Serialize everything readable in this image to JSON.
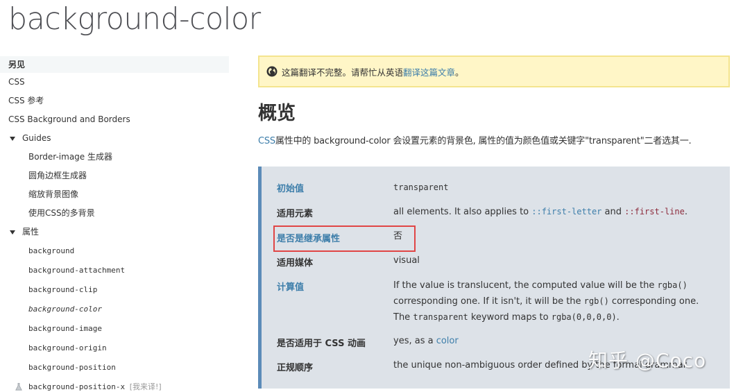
{
  "page": {
    "title": "background-color"
  },
  "sidebar": {
    "heading": "另见",
    "links": [
      "CSS",
      "CSS 参考",
      "CSS Background and Borders"
    ],
    "guides": {
      "label": "Guides",
      "items": [
        "Border-image 生成器",
        "圆角边框生成器",
        "缩放背景图像",
        "使用CSS的多背景"
      ]
    },
    "properties": {
      "label": "属性",
      "items": [
        {
          "name": "background"
        },
        {
          "name": "background-attachment"
        },
        {
          "name": "background-clip"
        },
        {
          "name": "background-color",
          "current": true
        },
        {
          "name": "background-image"
        },
        {
          "name": "background-origin"
        },
        {
          "name": "background-position"
        },
        {
          "name": "background-position-x",
          "experimental": true,
          "untranslated_label": "[我来译!]"
        }
      ]
    }
  },
  "notice": {
    "icon": "globe-icon",
    "text": "这篇翻译不完整。请帮忙从英语",
    "link": "翻译这篇文章",
    "suffix": "。"
  },
  "overview": {
    "title": "概览",
    "link": "CSS",
    "text": "属性中的 background-color 会设置元素的背景色, 属性的值为颜色值或关键字\"transparent\"二者选其一."
  },
  "properties_table": {
    "initial_value": {
      "key": "初始值",
      "value": "transparent"
    },
    "applies_to": {
      "key": "适用元素",
      "prefix": "all elements. It also applies to ",
      "code1": "::first-letter",
      "middle": " and ",
      "code2": "::first-line",
      "suffix": "."
    },
    "inherited": {
      "key": "是否是继承属性",
      "value": "否"
    },
    "media": {
      "key": "适用媒体",
      "value": "visual"
    },
    "computed": {
      "key": "计算值",
      "line1_text": "If the value is translucent, the computed value will be the ",
      "line1_code": "rgba()",
      "line2_text1": "corresponding one. If it isn't, it will be the ",
      "line2_code": "rgb()",
      "line2_text2": " corresponding one.",
      "line3_text1": "The ",
      "line3_code1": "transparent",
      "line3_text2": " keyword maps to ",
      "line3_code2": "rgba(0,0,0,0)",
      "line3_text3": "."
    },
    "animatable": {
      "key": "是否适用于 CSS 动画",
      "prefix": "yes, as a ",
      "link": "color"
    },
    "canonical_order": {
      "key": "正规顺序",
      "value": "the unique non-ambiguous order defined by the formal grammar"
    }
  },
  "watermark": "知乎 @Coco",
  "colors": {
    "link": "#3d7eaa",
    "notice_bg": "#fff6c7",
    "notice_border": "#f4e48e",
    "props_bg": "#dde2e8",
    "props_border": "#5b8bb8",
    "highlight": "#e04545"
  }
}
